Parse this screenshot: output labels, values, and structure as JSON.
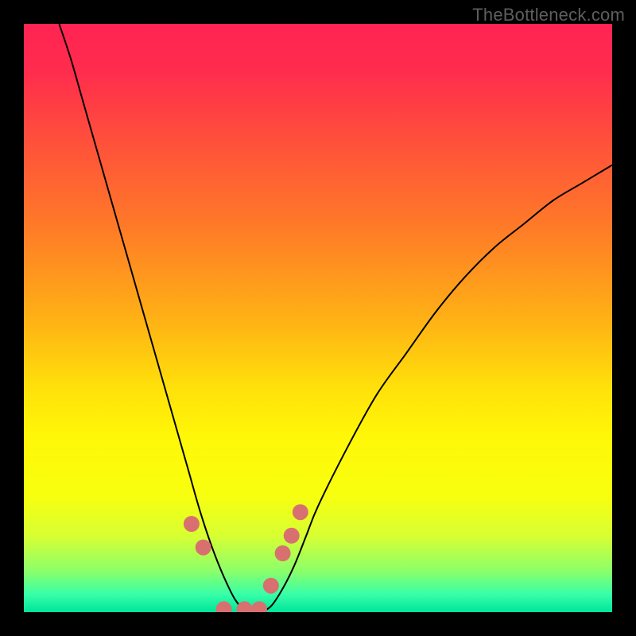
{
  "watermark": "TheBottleneck.com",
  "chart_data": {
    "type": "line",
    "title": "",
    "xlabel": "",
    "ylabel": "",
    "xlim": [
      0,
      100
    ],
    "ylim": [
      0,
      100
    ],
    "background_gradient": {
      "stops": [
        {
          "pos": 0.0,
          "color": "#ff2453"
        },
        {
          "pos": 0.08,
          "color": "#ff2c4d"
        },
        {
          "pos": 0.2,
          "color": "#ff503b"
        },
        {
          "pos": 0.35,
          "color": "#ff7c27"
        },
        {
          "pos": 0.5,
          "color": "#ffb015"
        },
        {
          "pos": 0.62,
          "color": "#ffe10a"
        },
        {
          "pos": 0.7,
          "color": "#fff708"
        },
        {
          "pos": 0.8,
          "color": "#f8ff0e"
        },
        {
          "pos": 0.87,
          "color": "#d8ff32"
        },
        {
          "pos": 0.93,
          "color": "#8cff6a"
        },
        {
          "pos": 0.97,
          "color": "#36ffa8"
        },
        {
          "pos": 1.0,
          "color": "#00e49b"
        }
      ]
    },
    "series": [
      {
        "name": "bottleneck-curve",
        "x": [
          6,
          8,
          10,
          12,
          14,
          16,
          18,
          20,
          22,
          24,
          26,
          28,
          30,
          32,
          34,
          36,
          38,
          40,
          42,
          44,
          46,
          48,
          50,
          55,
          60,
          65,
          70,
          75,
          80,
          85,
          90,
          95,
          100
        ],
        "values": [
          100,
          94,
          87,
          80,
          73,
          66,
          59,
          52,
          45,
          38,
          31,
          24,
          17,
          11,
          6,
          2,
          0,
          0,
          1,
          4,
          8,
          13,
          18,
          28,
          37,
          44,
          51,
          57,
          62,
          66,
          70,
          73,
          76
        ]
      }
    ],
    "markers": {
      "name": "highlight-points",
      "color": "#d97070",
      "radius": 10,
      "x": [
        28.5,
        30.5,
        34.0,
        37.5,
        40.0,
        42.0,
        44.0,
        45.5,
        47.0
      ],
      "values": [
        15.0,
        11.0,
        0.5,
        0.5,
        0.5,
        4.5,
        10.0,
        13.0,
        17.0
      ]
    }
  }
}
